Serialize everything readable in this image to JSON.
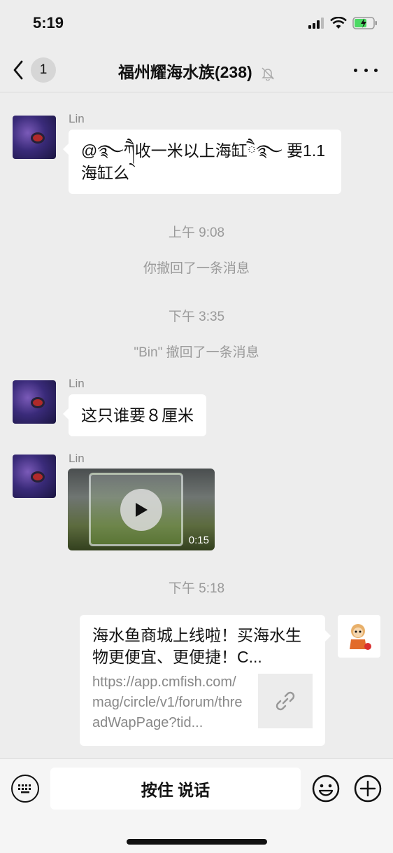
{
  "status_bar": {
    "time": "5:19"
  },
  "nav": {
    "back_count": "1",
    "title": "福州耀海水族(238)"
  },
  "messages": [
    {
      "sender": "Lin",
      "text": "@࿐ཀ྄ཻ收一米以上海缸ཻ࿐ 要1.1海缸么"
    },
    {
      "timestamp": "上午 9:08"
    },
    {
      "system": "你撤回了一条消息"
    },
    {
      "timestamp": "下午 3:35"
    },
    {
      "system": "\"Bin\" 撤回了一条消息"
    },
    {
      "sender": "Lin",
      "text": "这只谁要８厘米"
    },
    {
      "sender": "Lin",
      "video_duration": "0:15"
    },
    {
      "timestamp": "下午 5:18"
    }
  ],
  "link_card": {
    "title": "海水鱼商城上线啦！买海水生物更便宜、更便捷！C...",
    "url": "https://app.cmfish.com/mag/circle/v1/forum/threadWapPage?tid..."
  },
  "input_bar": {
    "talk_label": "按住 说话"
  },
  "icons": [
    "back-chevron-icon",
    "bell-off-icon",
    "more-icon",
    "play-icon",
    "link-icon",
    "keyboard-icon",
    "emoji-icon",
    "plus-icon"
  ]
}
